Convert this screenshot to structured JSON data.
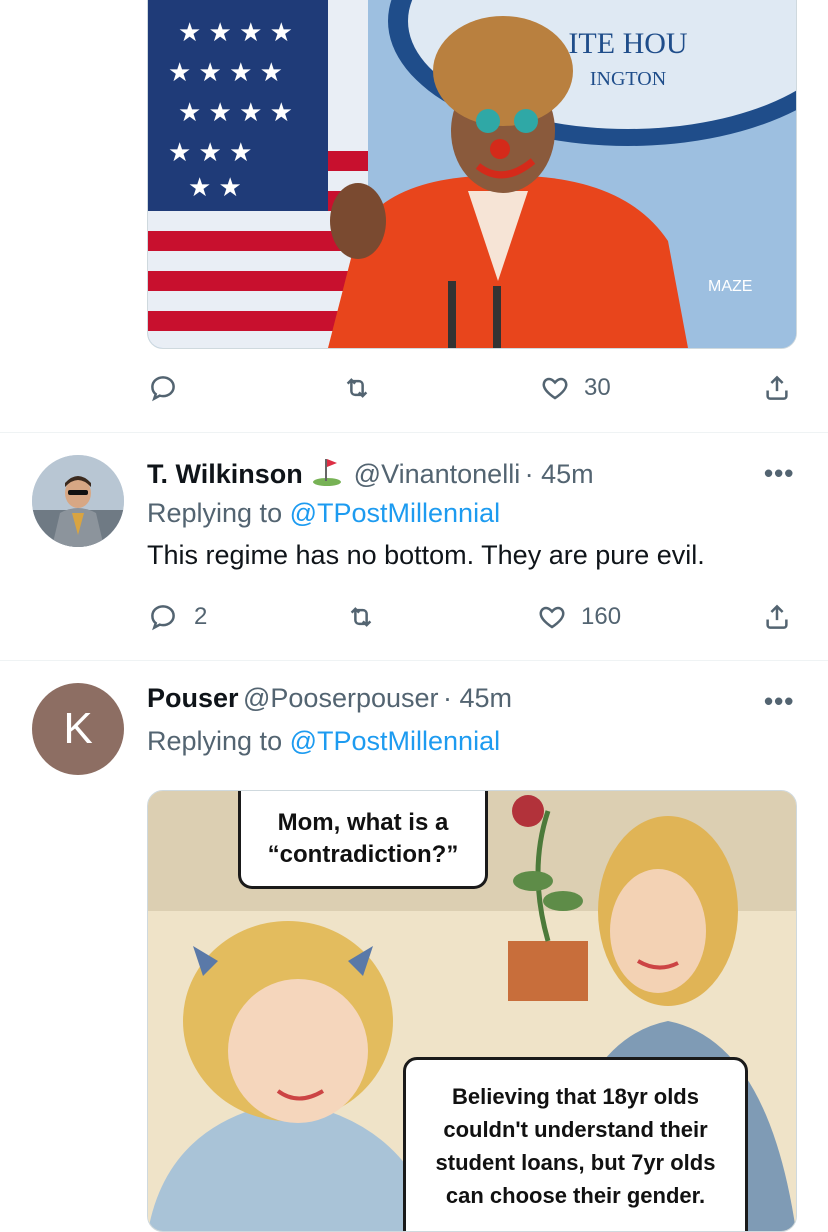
{
  "tweet1": {
    "image_caption_visible": [
      "ITE HOU",
      "INGTON",
      "MAZE"
    ],
    "actions": {
      "reply_count": "",
      "retweet_count": "",
      "like_count": "30"
    }
  },
  "tweet2": {
    "name": "T. Wilkinson",
    "handle": "@Vinantonelli",
    "time": "· 45m",
    "reply_prefix": "Replying to",
    "reply_to": "@TPostMillennial",
    "text": "This regime has no bottom. They are pure evil.",
    "actions": {
      "reply_count": "2",
      "like_count": "160"
    }
  },
  "tweet3": {
    "avatar_letter": "K",
    "name": "Pouser",
    "handle": "@Pooserpouser",
    "time": "· 45m",
    "reply_prefix": "Replying to",
    "reply_to": "@TPostMillennial",
    "meme": {
      "bubble_top_line1": "Mom, what is a",
      "bubble_top_line2": "“contradiction?”",
      "bubble_bottom_line1": "Believing that 18yr olds",
      "bubble_bottom_line2": "couldn't understand their",
      "bubble_bottom_line3": "student loans, but 7yr olds",
      "bubble_bottom_line4": "can choose their gender."
    }
  },
  "icons": [
    "reply-icon",
    "retweet-icon",
    "like-icon",
    "share-icon",
    "more-icon",
    "golf-flag-icon"
  ],
  "colors": {
    "link": "#1d9bf0",
    "secondary_text": "#536471",
    "divider": "#eff3f4",
    "avatar_k_bg": "#8d6e63"
  }
}
